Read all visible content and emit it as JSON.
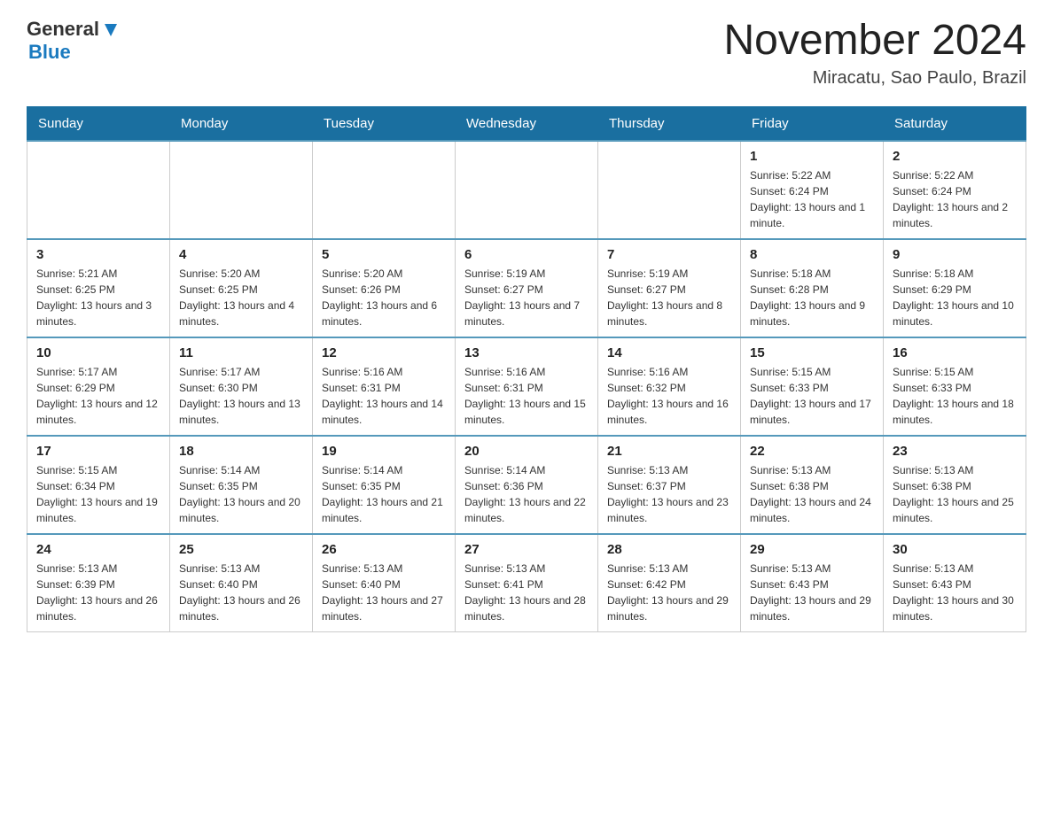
{
  "header": {
    "logo_general": "General",
    "logo_blue": "Blue",
    "month_title": "November 2024",
    "location": "Miracatu, Sao Paulo, Brazil"
  },
  "weekdays": [
    "Sunday",
    "Monday",
    "Tuesday",
    "Wednesday",
    "Thursday",
    "Friday",
    "Saturday"
  ],
  "weeks": [
    [
      {
        "day": "",
        "info": ""
      },
      {
        "day": "",
        "info": ""
      },
      {
        "day": "",
        "info": ""
      },
      {
        "day": "",
        "info": ""
      },
      {
        "day": "",
        "info": ""
      },
      {
        "day": "1",
        "info": "Sunrise: 5:22 AM\nSunset: 6:24 PM\nDaylight: 13 hours and 1 minute."
      },
      {
        "day": "2",
        "info": "Sunrise: 5:22 AM\nSunset: 6:24 PM\nDaylight: 13 hours and 2 minutes."
      }
    ],
    [
      {
        "day": "3",
        "info": "Sunrise: 5:21 AM\nSunset: 6:25 PM\nDaylight: 13 hours and 3 minutes."
      },
      {
        "day": "4",
        "info": "Sunrise: 5:20 AM\nSunset: 6:25 PM\nDaylight: 13 hours and 4 minutes."
      },
      {
        "day": "5",
        "info": "Sunrise: 5:20 AM\nSunset: 6:26 PM\nDaylight: 13 hours and 6 minutes."
      },
      {
        "day": "6",
        "info": "Sunrise: 5:19 AM\nSunset: 6:27 PM\nDaylight: 13 hours and 7 minutes."
      },
      {
        "day": "7",
        "info": "Sunrise: 5:19 AM\nSunset: 6:27 PM\nDaylight: 13 hours and 8 minutes."
      },
      {
        "day": "8",
        "info": "Sunrise: 5:18 AM\nSunset: 6:28 PM\nDaylight: 13 hours and 9 minutes."
      },
      {
        "day": "9",
        "info": "Sunrise: 5:18 AM\nSunset: 6:29 PM\nDaylight: 13 hours and 10 minutes."
      }
    ],
    [
      {
        "day": "10",
        "info": "Sunrise: 5:17 AM\nSunset: 6:29 PM\nDaylight: 13 hours and 12 minutes."
      },
      {
        "day": "11",
        "info": "Sunrise: 5:17 AM\nSunset: 6:30 PM\nDaylight: 13 hours and 13 minutes."
      },
      {
        "day": "12",
        "info": "Sunrise: 5:16 AM\nSunset: 6:31 PM\nDaylight: 13 hours and 14 minutes."
      },
      {
        "day": "13",
        "info": "Sunrise: 5:16 AM\nSunset: 6:31 PM\nDaylight: 13 hours and 15 minutes."
      },
      {
        "day": "14",
        "info": "Sunrise: 5:16 AM\nSunset: 6:32 PM\nDaylight: 13 hours and 16 minutes."
      },
      {
        "day": "15",
        "info": "Sunrise: 5:15 AM\nSunset: 6:33 PM\nDaylight: 13 hours and 17 minutes."
      },
      {
        "day": "16",
        "info": "Sunrise: 5:15 AM\nSunset: 6:33 PM\nDaylight: 13 hours and 18 minutes."
      }
    ],
    [
      {
        "day": "17",
        "info": "Sunrise: 5:15 AM\nSunset: 6:34 PM\nDaylight: 13 hours and 19 minutes."
      },
      {
        "day": "18",
        "info": "Sunrise: 5:14 AM\nSunset: 6:35 PM\nDaylight: 13 hours and 20 minutes."
      },
      {
        "day": "19",
        "info": "Sunrise: 5:14 AM\nSunset: 6:35 PM\nDaylight: 13 hours and 21 minutes."
      },
      {
        "day": "20",
        "info": "Sunrise: 5:14 AM\nSunset: 6:36 PM\nDaylight: 13 hours and 22 minutes."
      },
      {
        "day": "21",
        "info": "Sunrise: 5:13 AM\nSunset: 6:37 PM\nDaylight: 13 hours and 23 minutes."
      },
      {
        "day": "22",
        "info": "Sunrise: 5:13 AM\nSunset: 6:38 PM\nDaylight: 13 hours and 24 minutes."
      },
      {
        "day": "23",
        "info": "Sunrise: 5:13 AM\nSunset: 6:38 PM\nDaylight: 13 hours and 25 minutes."
      }
    ],
    [
      {
        "day": "24",
        "info": "Sunrise: 5:13 AM\nSunset: 6:39 PM\nDaylight: 13 hours and 26 minutes."
      },
      {
        "day": "25",
        "info": "Sunrise: 5:13 AM\nSunset: 6:40 PM\nDaylight: 13 hours and 26 minutes."
      },
      {
        "day": "26",
        "info": "Sunrise: 5:13 AM\nSunset: 6:40 PM\nDaylight: 13 hours and 27 minutes."
      },
      {
        "day": "27",
        "info": "Sunrise: 5:13 AM\nSunset: 6:41 PM\nDaylight: 13 hours and 28 minutes."
      },
      {
        "day": "28",
        "info": "Sunrise: 5:13 AM\nSunset: 6:42 PM\nDaylight: 13 hours and 29 minutes."
      },
      {
        "day": "29",
        "info": "Sunrise: 5:13 AM\nSunset: 6:43 PM\nDaylight: 13 hours and 29 minutes."
      },
      {
        "day": "30",
        "info": "Sunrise: 5:13 AM\nSunset: 6:43 PM\nDaylight: 13 hours and 30 minutes."
      }
    ]
  ]
}
